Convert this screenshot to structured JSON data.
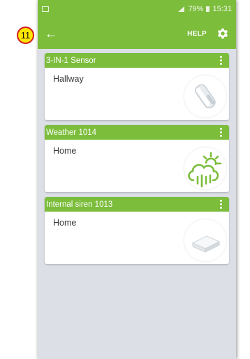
{
  "tutorial_step": "11",
  "status_bar": {
    "battery": "79%",
    "time": "15:31"
  },
  "app_bar": {
    "help_label": "HELP"
  },
  "devices": [
    {
      "name": "3-IN-1 Sensor",
      "location": "Hallway",
      "icon": "motion-sensor-icon"
    },
    {
      "name": "Weather 1014",
      "location": "Home",
      "icon": "weather-icon"
    },
    {
      "name": "Internal siren 1013",
      "location": "Home",
      "icon": "siren-icon"
    }
  ],
  "colors": {
    "accent": "#7cbd3c",
    "background": "#dcdfe6",
    "badge": "#ffe600",
    "badge_border": "#d11d1d"
  }
}
